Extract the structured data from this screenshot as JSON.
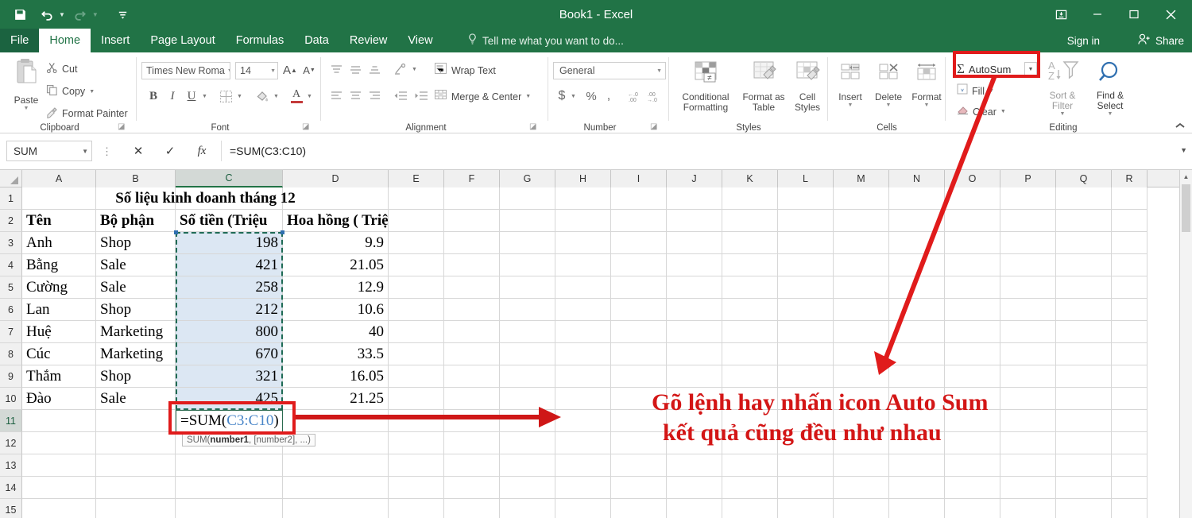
{
  "window": {
    "title": "Book1 - Excel",
    "quick_access": [
      {
        "name": "save-icon",
        "glyph": "💾"
      },
      {
        "name": "undo-icon",
        "glyph": "↶"
      },
      {
        "name": "redo-icon",
        "glyph": "↷"
      },
      {
        "name": "customize-qat-icon",
        "glyph": "☰"
      }
    ],
    "controls": {
      "ribbon_display": "Ribbon Display Options",
      "minimize": "Minimize",
      "maximize": "Maximize",
      "close": "Close"
    },
    "sign_in": "Sign in",
    "share": "Share"
  },
  "tabs": [
    {
      "label": "File"
    },
    {
      "label": "Home"
    },
    {
      "label": "Insert"
    },
    {
      "label": "Page Layout"
    },
    {
      "label": "Formulas"
    },
    {
      "label": "Data"
    },
    {
      "label": "Review"
    },
    {
      "label": "View"
    }
  ],
  "active_tab": "Home",
  "tell_me": "Tell me what you want to do...",
  "ribbon": {
    "clipboard": {
      "label": "Clipboard",
      "paste": "Paste",
      "cut": "Cut",
      "copy": "Copy",
      "format_painter": "Format Painter"
    },
    "font": {
      "label": "Font",
      "font_name": "Times New Roma",
      "font_size": "14",
      "grow": "A",
      "shrink": "A",
      "bold": "B",
      "italic": "I",
      "underline": "U",
      "font_color": "A"
    },
    "alignment": {
      "label": "Alignment",
      "wrap_text": "Wrap Text",
      "merge_center": "Merge & Center"
    },
    "number": {
      "label": "Number",
      "format": "General",
      "currency": "$",
      "percent": "%",
      "comma": ",",
      "inc_decimal": ".00",
      "dec_decimal": ".0"
    },
    "styles": {
      "label": "Styles",
      "conditional_formatting": "Conditional Formatting",
      "format_as_table": "Format as Table",
      "cell_styles": "Cell Styles"
    },
    "cells": {
      "label": "Cells",
      "insert": "Insert",
      "delete": "Delete",
      "format": "Format"
    },
    "editing": {
      "label": "Editing",
      "autosum": "AutoSum",
      "fill": "Fill",
      "clear": "Clear",
      "sort_filter": "Sort & Filter",
      "find_select": "Find & Select"
    },
    "collapse": "Collapse the Ribbon"
  },
  "formula_bar": {
    "name_box": "SUM",
    "cancel": "✕",
    "enter": "✓",
    "insert_function": "fx",
    "formula": "=SUM(C3:C10)"
  },
  "grid": {
    "column_headers": [
      "A",
      "B",
      "C",
      "D",
      "E",
      "F",
      "G",
      "H",
      "I",
      "J",
      "K",
      "L",
      "M",
      "N",
      "O",
      "P",
      "Q",
      "R"
    ],
    "selected_column": "C",
    "row_headers": [
      "1",
      "2",
      "3",
      "4",
      "5",
      "6",
      "7",
      "8",
      "9",
      "10",
      "11",
      "12",
      "13",
      "14",
      "15"
    ],
    "active_row": "11",
    "title_cell": "Số liệu kinh doanh tháng 12",
    "headers": {
      "a": "Tên",
      "b": "Bộ phận",
      "c": "Số tiền (Triệu",
      "d": "Hoa hồng ( Triệu)"
    },
    "rows": [
      {
        "row": "3",
        "name": "Anh",
        "dept": "Shop",
        "amount": "198",
        "commission": "9.9"
      },
      {
        "row": "4",
        "name": "Bằng",
        "dept": "Sale",
        "amount": "421",
        "commission": "21.05"
      },
      {
        "row": "5",
        "name": "Cường",
        "dept": "Sale",
        "amount": "258",
        "commission": "12.9"
      },
      {
        "row": "6",
        "name": "Lan",
        "dept": "Shop",
        "amount": "212",
        "commission": "10.6"
      },
      {
        "row": "7",
        "name": "Huệ",
        "dept": "Marketing",
        "amount": "800",
        "commission": "40"
      },
      {
        "row": "8",
        "name": "Cúc",
        "dept": "Marketing",
        "amount": "670",
        "commission": "33.5"
      },
      {
        "row": "9",
        "name": "Thắm",
        "dept": "Shop",
        "amount": "321",
        "commission": "16.05"
      },
      {
        "row": "10",
        "name": "Đào",
        "dept": "Sale",
        "amount": "425",
        "commission": "21.25"
      }
    ],
    "edit_cell": {
      "address": "C11",
      "prefix": "=SUM(",
      "range": "C3:C10",
      "suffix": ")"
    },
    "function_tooltip_prefix": "SUM(",
    "function_tooltip_bold": "number1",
    "function_tooltip_suffix": ", [number2], ...)",
    "marquee_range": "C3:C10"
  },
  "annotations": {
    "line1": "Gõ lệnh hay nhấn icon Auto Sum",
    "line2": "kết quả cũng đều như nhau",
    "color": "#d31616",
    "highlight_target": "AutoSum"
  }
}
